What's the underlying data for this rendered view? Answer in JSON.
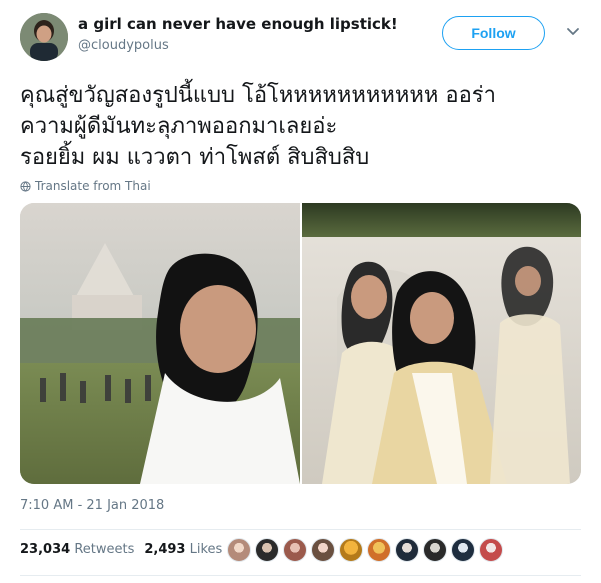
{
  "tweet": {
    "author_name": "a girl can never have enough lipstick!",
    "handle": "@cloudypolus",
    "follow_label": "Follow",
    "text": "คุณสู่ขวัญสองรูปนี้แบบ โอ้โหหหหหหหหหหห ออร่า\nความผู้ดีมันทะลุภาพออกมาเลยอ่ะ\nรอยยิ้ม ผม แววตา ท่าโพสต์ สิบสิบสิบ",
    "translate_label": "Translate from Thai",
    "timestamp": "7:10 AM - 21 Jan 2018",
    "retweets_count": "23,034",
    "retweets_label": "Retweets",
    "likes_count": "2,493",
    "likes_label": "Likes"
  },
  "icons": {
    "chevron": "chevron-down-icon",
    "translate": "globe-icon"
  },
  "colors": {
    "accent": "#1da1f2",
    "text": "#14171a",
    "muted": "#657786"
  },
  "likers_count": 10
}
